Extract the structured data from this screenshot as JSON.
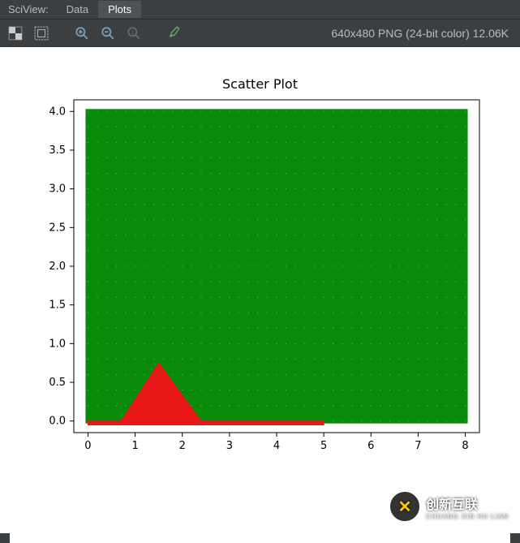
{
  "header": {
    "title": "SciView:",
    "tabs": [
      {
        "label": "Data",
        "active": false
      },
      {
        "label": "Plots",
        "active": true
      }
    ]
  },
  "toolbar": {
    "icons": [
      "checker-icon",
      "fit-icon",
      "zoom-in-icon",
      "zoom-out-icon",
      "zoom-reset-icon",
      "eyedropper-icon"
    ],
    "status": "640x480 PNG (24-bit color) 12.06K"
  },
  "watermark": {
    "main": "创新互联",
    "sub": "CHUANG XIN HU LIAN",
    "logo_text": "✕"
  },
  "chart_data": {
    "type": "scatter",
    "title": "Scatter Plot",
    "xlabel": "",
    "ylabel": "",
    "xlim": [
      -0.3,
      8.3
    ],
    "ylim": [
      -0.15,
      4.15
    ],
    "xticks": [
      0,
      1,
      2,
      3,
      4,
      5,
      6,
      7,
      8
    ],
    "yticks": [
      0.0,
      0.5,
      1.0,
      1.5,
      2.0,
      2.5,
      3.0,
      3.5,
      4.0
    ],
    "background_grid": {
      "color": "#0a8a0a",
      "x_range": [
        0.0,
        8.0
      ],
      "y_range": [
        0.0,
        4.0
      ],
      "step": 0.1
    },
    "red_region": {
      "color": "#e81818",
      "description": "triangular peak near x≈1.5 with flat tail to x≈5",
      "polygon": [
        [
          0.0,
          0.0
        ],
        [
          0.7,
          0.0
        ],
        [
          1.5,
          0.75
        ],
        [
          2.4,
          0.0
        ],
        [
          5.0,
          0.0
        ],
        [
          5.0,
          -0.05
        ],
        [
          0.0,
          -0.05
        ]
      ]
    }
  }
}
